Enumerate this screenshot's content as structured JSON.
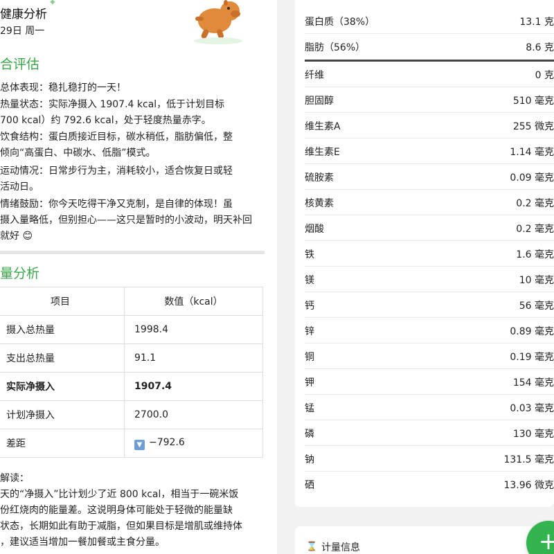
{
  "left": {
    "header": {
      "title": "健康分析",
      "date": "29日 周一"
    },
    "overall": {
      "title": "合评估",
      "items": [
        [
          "总体表现：稳扎稳打的一天！"
        ],
        [
          "热量状态：实际净摄入 1907.4 kcal，低于计划目标",
          "700 kcal）约 792.6 kcal，处于轻度热量赤字。"
        ],
        [
          "饮食结构：蛋白质接近目标，碳水稍低，脂肪偏低，整",
          "倾向“高蛋白、中碳水、低脂”模式。"
        ],
        [
          "运动情况：日常步行为主，消耗较小，适合恢复日或轻",
          "活动日。"
        ],
        [
          "情绪鼓励：你今天吃得干净又克制，是自律的体现！虽",
          "摄入量略低，但别担心——这只是暂时的小波动，明天补回",
          "就好 😊"
        ]
      ]
    },
    "energy": {
      "title": "量分析",
      "table": {
        "headers": [
          "项目",
          "数值（kcal）"
        ],
        "rows": [
          [
            "摄入总热量",
            "1998.4"
          ],
          [
            "支出总热量",
            "91.1"
          ],
          [
            "实际净摄入",
            "1907.4"
          ],
          [
            "计划净摄入",
            "2700.0"
          ],
          [
            "差距",
            "−792.6"
          ]
        ]
      },
      "interpretation": [
        "解读：",
        "天的“净摄入”比计划少了近 800 kcal，相当于一碗米饭",
        "份红烧肉的能量差。这说明身体可能处于轻微的能量缺",
        "状态，长期如此有助于减脂，但如果目标是增肌或维持体",
        "，建议适当增加一餐加餐或主食分量。"
      ]
    }
  },
  "right": {
    "nutrients": [
      {
        "label": "蛋白质（38%）",
        "value": "13.1 克"
      },
      {
        "label": "脂肪（56%）",
        "value": "8.6 克"
      },
      {
        "label": "纤维",
        "value": "0 克"
      },
      {
        "label": "胆固醇",
        "value": "510 毫克"
      },
      {
        "label": "维生素A",
        "value": "255 微克"
      },
      {
        "label": "维生素E",
        "value": "1.14 毫克"
      },
      {
        "label": "硫胺素",
        "value": "0.09 毫克"
      },
      {
        "label": "核黄素",
        "value": "0.2 毫克"
      },
      {
        "label": "烟酸",
        "value": "0.2 毫克"
      },
      {
        "label": "铁",
        "value": "1.6 毫克"
      },
      {
        "label": "镁",
        "value": "10 毫克"
      },
      {
        "label": "钙",
        "value": "56 毫克"
      },
      {
        "label": "锌",
        "value": "0.89 毫克"
      },
      {
        "label": "铜",
        "value": "0.19 毫克"
      },
      {
        "label": "钾",
        "value": "154 毫克"
      },
      {
        "label": "锰",
        "value": "0.03 毫克"
      },
      {
        "label": "磷",
        "value": "130 毫克"
      },
      {
        "label": "钠",
        "value": "131.5 毫克"
      },
      {
        "label": "硒",
        "value": "13.96 微克"
      }
    ],
    "calc_info": "计量信息",
    "fab_icon": "+"
  }
}
